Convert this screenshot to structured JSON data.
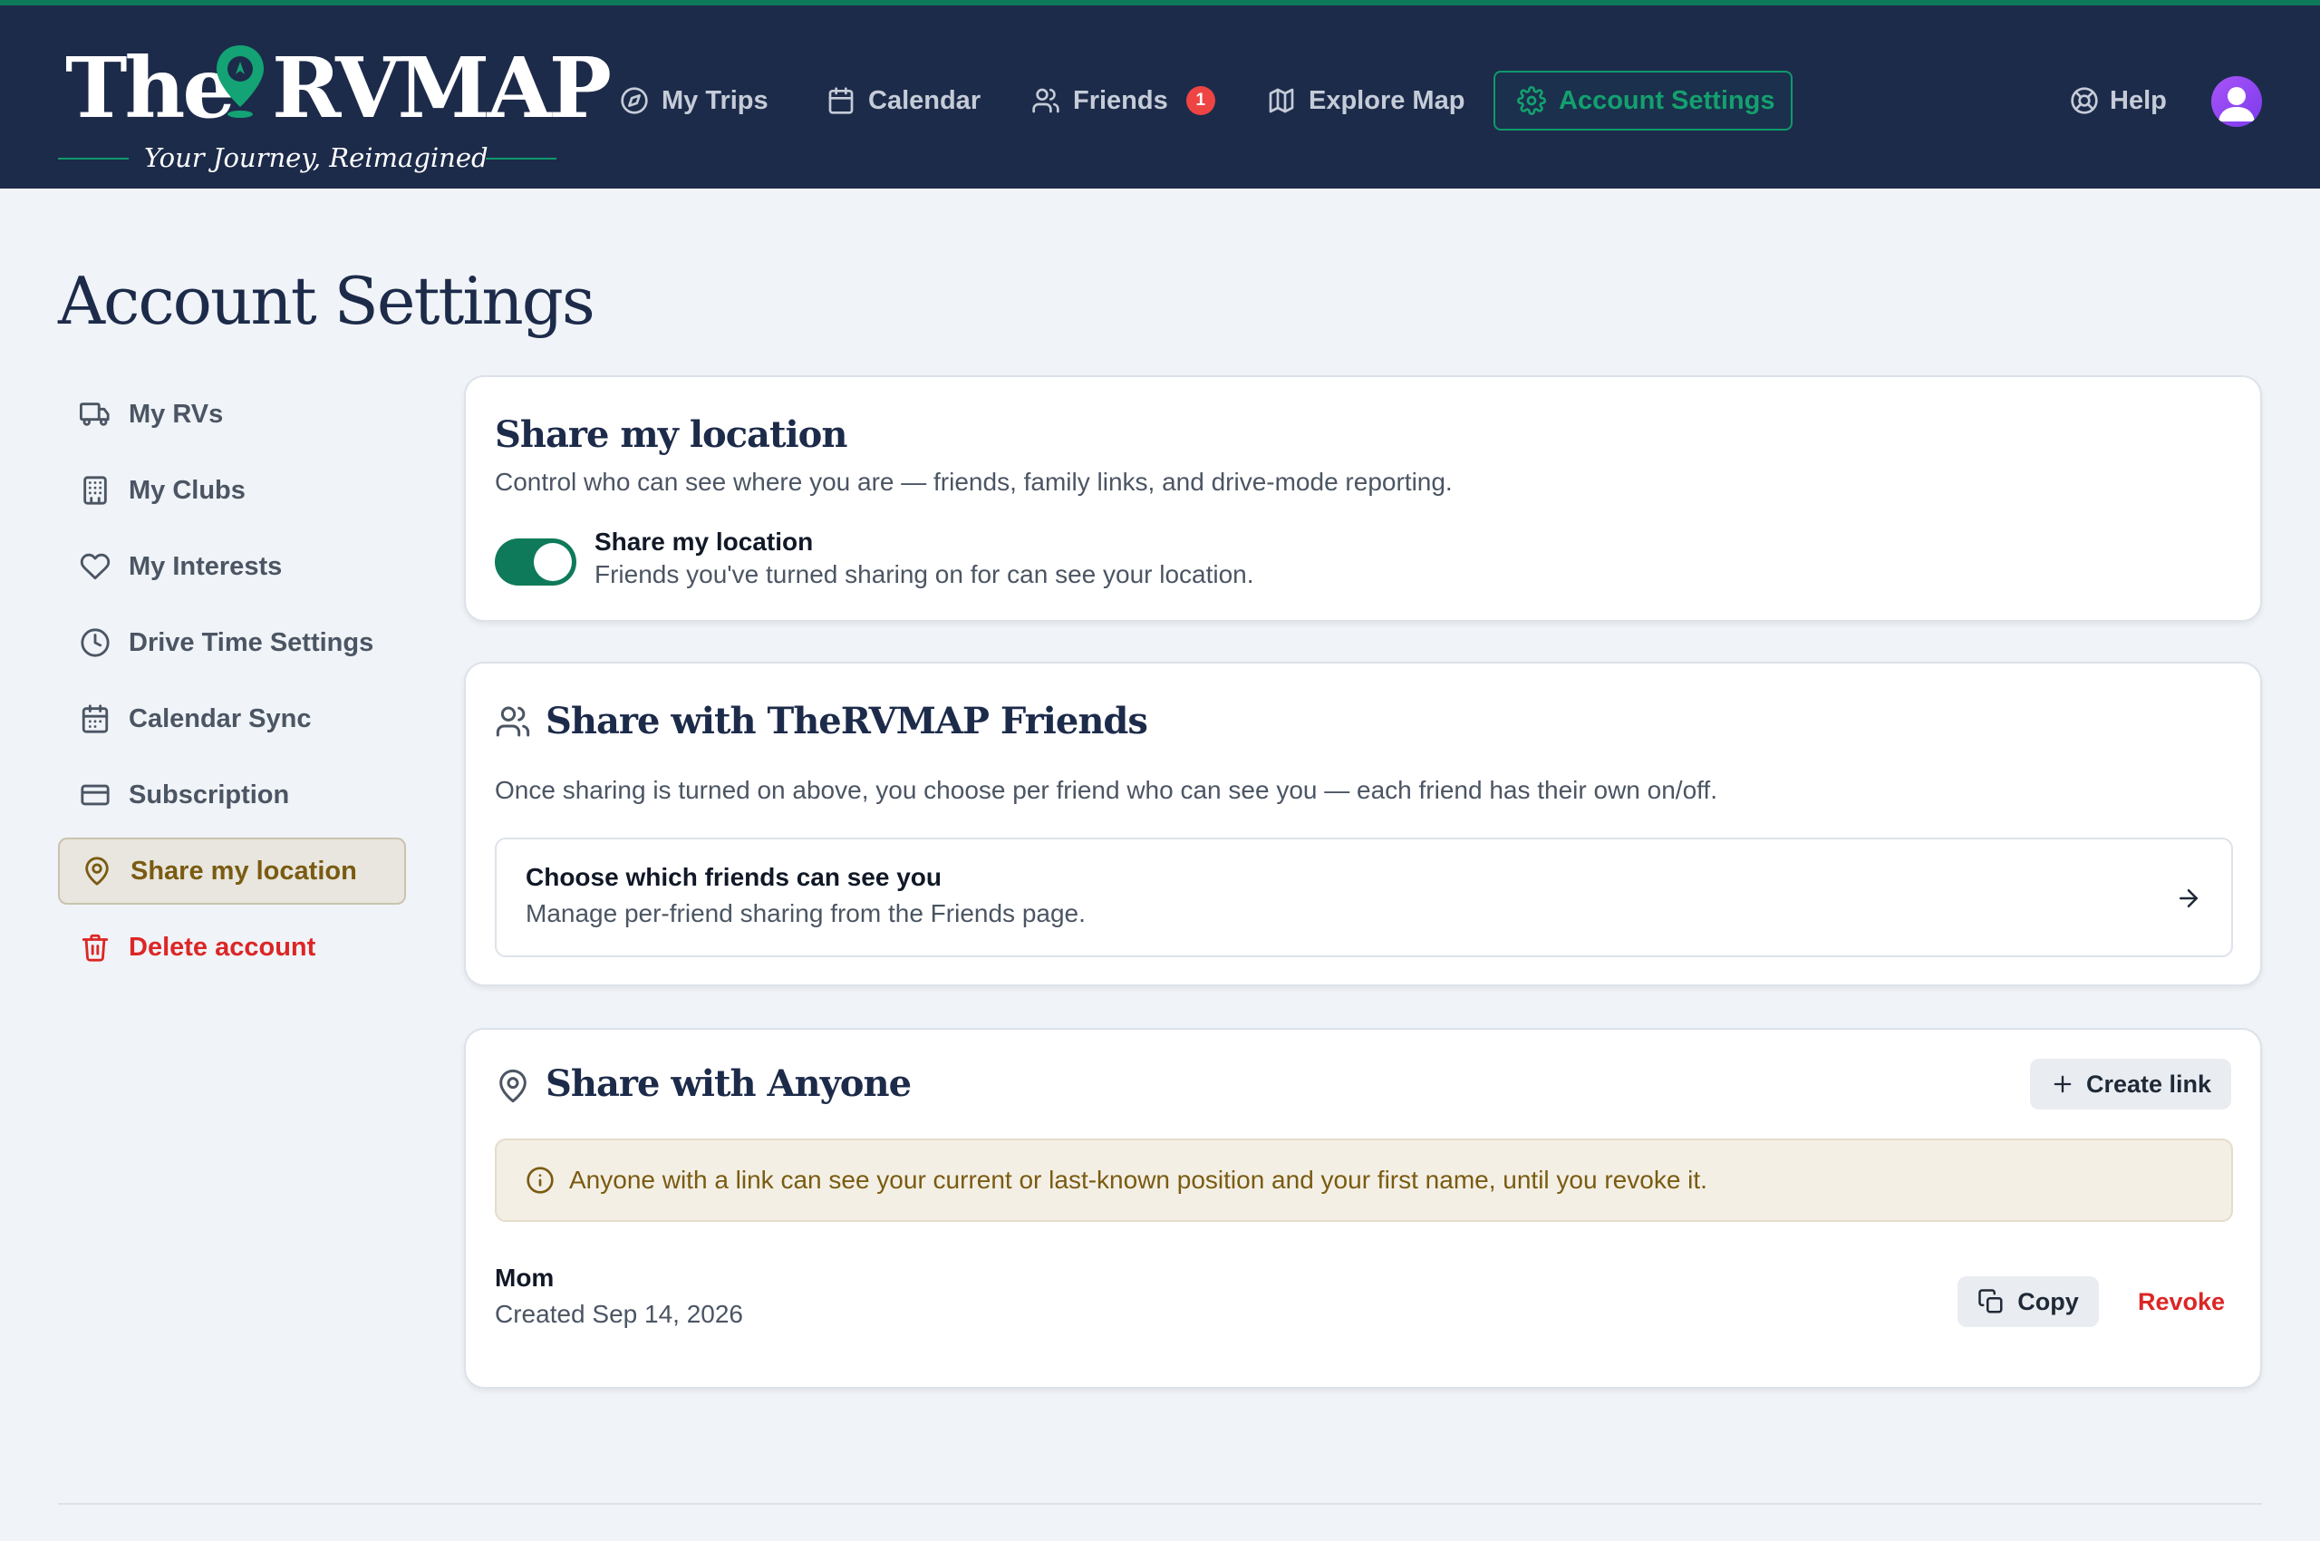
{
  "colors": {
    "navbar_bg": "#1d2b4a",
    "accent_green": "#0f7a5a",
    "danger_red": "#dc2626",
    "active_gold": "#7a5b12",
    "badge_red": "#ef4444"
  },
  "brand": {
    "word_the": "The",
    "word_rvmap": "RVMAP",
    "tagline": "Your Journey, Reimagined"
  },
  "nav": {
    "my_trips": "My Trips",
    "calendar": "Calendar",
    "friends": "Friends",
    "friends_badge": "1",
    "explore_map": "Explore Map",
    "account_settings": "Account Settings",
    "help": "Help"
  },
  "page": {
    "title": "Account Settings"
  },
  "sidebar": {
    "items": [
      {
        "label": "My RVs",
        "icon": "truck-icon"
      },
      {
        "label": "My Clubs",
        "icon": "building-icon"
      },
      {
        "label": "My Interests",
        "icon": "heart-icon"
      },
      {
        "label": "Drive Time Settings",
        "icon": "clock-icon"
      },
      {
        "label": "Calendar Sync",
        "icon": "calendar-icon"
      },
      {
        "label": "Subscription",
        "icon": "credit-card-icon"
      },
      {
        "label": "Share my location",
        "icon": "map-pin-icon",
        "active": true
      },
      {
        "label": "Delete account",
        "icon": "trash-icon",
        "danger": true
      }
    ]
  },
  "share_location": {
    "title": "Share my location",
    "description": "Control who can see where you are — friends, family links, and drive-mode reporting.",
    "toggle_on": true,
    "toggle_label": "Share my location",
    "toggle_sub": "Friends you've turned sharing on for can see your location."
  },
  "share_friends": {
    "title": "Share with TheRVMAP Friends",
    "description": "Once sharing is turned on above, you choose per friend who can see you — each friend has their own on/off.",
    "box_title": "Choose which friends can see you",
    "box_sub": "Manage per-friend sharing from the Friends page."
  },
  "share_anyone": {
    "title": "Share with Anyone",
    "create_label": "Create link",
    "notice": "Anyone with a link can see your current or last-known position and your first name, until you revoke it.",
    "links": [
      {
        "name": "Mom",
        "created": "Created Sep 14, 2026",
        "copy_label": "Copy",
        "revoke_label": "Revoke"
      }
    ]
  }
}
